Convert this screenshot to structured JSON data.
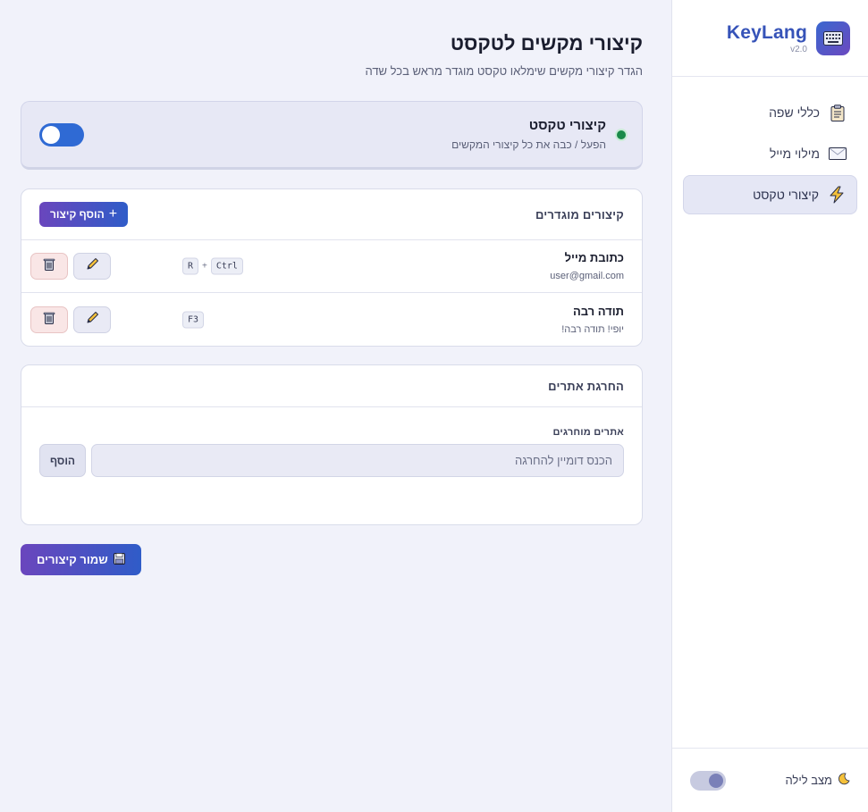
{
  "app": {
    "name": "KeyLang",
    "version": "v2.0",
    "logo_icon": "keyboard-icon"
  },
  "sidebar": {
    "items": [
      {
        "label": "כללי שפה",
        "icon": "clipboard-icon",
        "active": false
      },
      {
        "label": "מילוי מייל",
        "icon": "envelope-icon",
        "active": false
      },
      {
        "label": "קיצורי טקסט",
        "icon": "lightning-icon",
        "active": true
      }
    ],
    "night_mode_label": "מצב לילה",
    "night_mode_on": false
  },
  "page": {
    "title": "קיצורי מקשים לטקסט",
    "subtitle": "הגדר קיצורי מקשים שימלאו טקסט מוגדר מראש בכל שדה"
  },
  "master_toggle": {
    "title": "קיצורי טקסט",
    "description": "הפעל / כבה את כל קיצורי המקשים",
    "enabled": true,
    "status_color": "#1a8a4a"
  },
  "shortcuts": {
    "header": "קיצורים מוגדרים",
    "add_label": "הוסף קיצור",
    "rows": [
      {
        "name": "כתובת מייל",
        "value": "user@gmail.com",
        "keys": [
          "Ctrl",
          "R"
        ]
      },
      {
        "name": "תודה רבה",
        "value": "יופי! תודה רבה!",
        "keys": [
          "F3"
        ]
      }
    ]
  },
  "blocking": {
    "header": "החרגת אתרים",
    "field_label": "אתרים מוחרגים",
    "input_placeholder": "הכנס דומיין להחרגה",
    "input_value": "",
    "add_label": "הוסף"
  },
  "save_label": "שמור קיצורים",
  "colors": {
    "accent": "#2f5cc8",
    "accent_secondary": "#6a46bd",
    "background": "#f1f2fa"
  }
}
